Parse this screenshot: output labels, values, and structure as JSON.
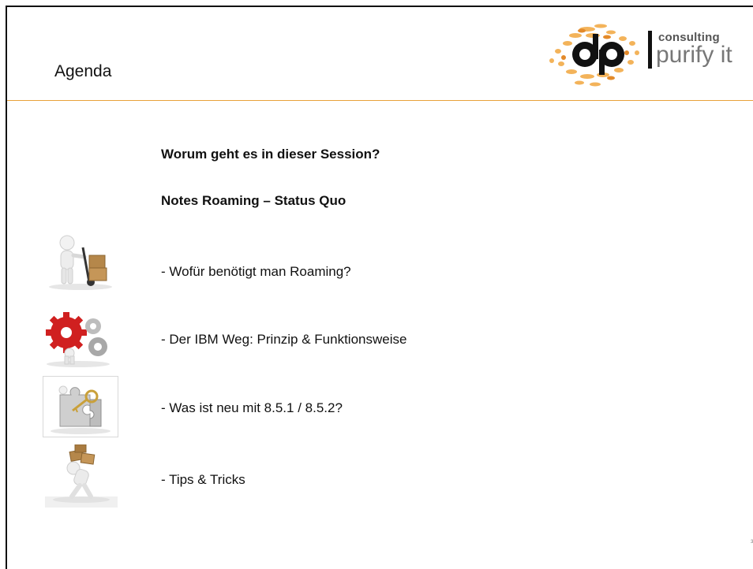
{
  "slide": {
    "title": "Agenda",
    "headings": [
      "Worum geht es in dieser Session?",
      "Notes Roaming – Status Quo"
    ],
    "items": [
      "- Wofür benötigt man Roaming?",
      "- Der IBM Weg: Prinzip & Funktionsweise",
      "- Was ist neu mit 8.5.1 / 8.5.2?",
      "- Tips & Tricks"
    ],
    "page_number": "3"
  },
  "logo": {
    "mark": "dp",
    "line1": "consulting",
    "line2": "purify it"
  },
  "colors": {
    "accent_rule": "#e8a23a",
    "logo_orange": "#f0a040",
    "gear_red": "#d02020"
  },
  "icons": [
    "person-with-handtruck-icon",
    "person-with-gears-icon",
    "puzzle-key-icon",
    "person-carrying-boxes-icon"
  ]
}
